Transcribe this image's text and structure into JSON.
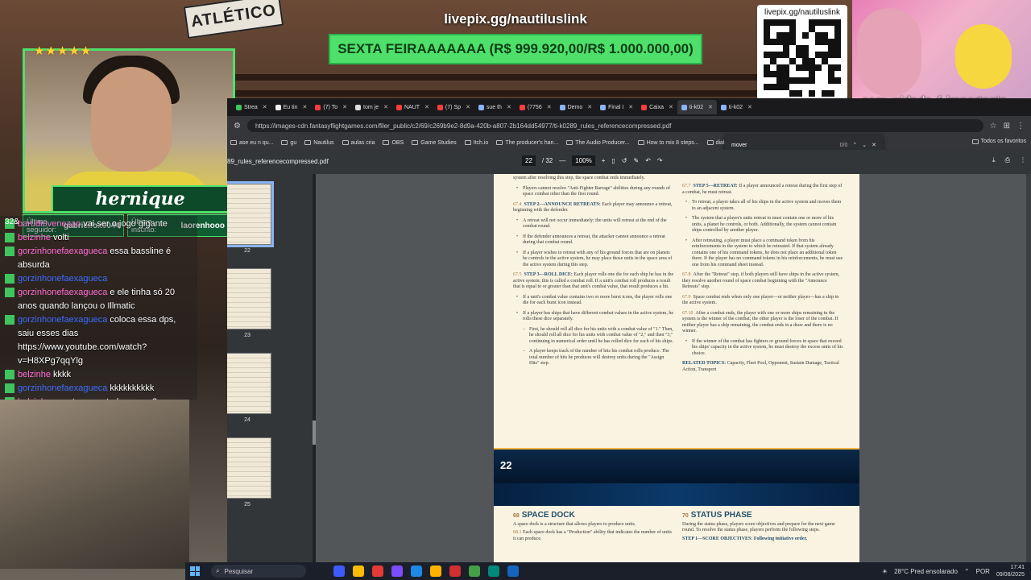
{
  "stream": {
    "overlay_url": "livepix.gg/nautiluslink",
    "goal_text": "SEXTA FEIRAAAAAAA (R$ 999.920,00/R$ 1.000.000,00)",
    "qr_url": "livepix.gg/nautiluslink",
    "cartoon_caption": "comunidade é importante",
    "pennant_text": "ATLÉTICO",
    "streamer_name": "hernique",
    "last_follower_label": "Último seguidor:",
    "last_follower": "gabrielfox0044",
    "last_subscriber_label": "Último inscrito:",
    "last_subscriber": "laorenhooo",
    "stars": "★★★★★",
    "chat_count": "32&",
    "chat": [
      {
        "user": "barudiovenezan",
        "msg": "vai ser o jogo gigante",
        "user_color": "#ff6bd5"
      },
      {
        "user": "belzinhe",
        "msg": "volti",
        "user_color": "#ff6bd5"
      },
      {
        "user": "gorzinhonefaexagueca",
        "msg": "essa bassline é absurda",
        "user_color": "#ff6bd5"
      },
      {
        "user": "gorzinhonefaexagueca",
        "msg": "",
        "user_color": "#3b6cff"
      },
      {
        "user": "gorzinhonefaexagueca",
        "msg": "e ele tinha só 20 anos quando lançou o Illmatic",
        "user_color": "#ff6bd5"
      },
      {
        "user": "gorzinhonefaexagueca",
        "msg": "coloca essa dps, saiu esses dias https://www.youtube.com/watch?v=H8XPg7qqYlg",
        "user_color": "#3b6cff"
      },
      {
        "user": "belzinhe",
        "msg": "kkkk",
        "user_color": "#ff6bd5"
      },
      {
        "user": "gorzinhonefaexagueca",
        "msg": "kkkkkkkkkk",
        "user_color": "#3b6cff"
      },
      {
        "user": "belzinhe",
        "msg": "mas toca em todos os ap?",
        "user_color": "#ff6bd5"
      }
    ]
  },
  "browser": {
    "tabs": [
      {
        "label": "Strea",
        "color": "#3fc45e"
      },
      {
        "label": "Eu tin",
        "color": "#f2f2f2"
      },
      {
        "label": "(7) To",
        "color": "#ff3d3d"
      },
      {
        "label": "tom je",
        "color": "#dddddd"
      },
      {
        "label": "NAUT",
        "color": "#ff3d3d"
      },
      {
        "label": "(7) Sp",
        "color": "#ff3d3d"
      },
      {
        "label": "sue th",
        "color": "#8ab4f8"
      },
      {
        "label": "(7756",
        "color": "#ff3d3d"
      },
      {
        "label": "Demo",
        "color": "#8ab4f8"
      },
      {
        "label": "Final I",
        "color": "#8ab4f8"
      },
      {
        "label": "Caixa",
        "color": "#ff3d3d"
      },
      {
        "label": "ti-k02",
        "color": "#8ab4f8"
      },
      {
        "label": "ti-k02",
        "color": "#8ab4f8"
      }
    ],
    "url": "https://images-cdn.fantasyflightgames.com/filer_public/c2/69/c269b9e2-8d9a-420b-a807-2b164dd54977/ti-k0289_rules_referencecompressed.pdf",
    "bookmarks": [
      "ase eu n qu...",
      "gu",
      "Nautilus",
      "aulas cria",
      "OBS",
      "Game Studies",
      "Itch.io",
      "The producer's han...",
      "The Audio Producer...",
      "How to mix 8 steps...",
      "dialog"
    ],
    "bookmarks_right": "Todos os favoritos",
    "find": {
      "value": "mover",
      "count": "0/0"
    },
    "pdf": {
      "filename": "89_rules_referencecompressed.pdf",
      "page_current": "22",
      "page_total": "/ 32",
      "zoom": "100%",
      "thumbnails": [
        "22",
        "23",
        "24",
        "25"
      ],
      "page_number_footer": "22",
      "left_column": [
        {
          "type": "text",
          "text": "system after resolving this step, the space combat ends immediately."
        },
        {
          "type": "bullet",
          "text": "Players cannot resolve \"Anti-Fighter Barrage\" abilities during any rounds of space combat other than the first round."
        },
        {
          "type": "head",
          "num": "67.4",
          "head": "STEP 2—ANNOUNCE RETREATS:",
          "text": "Each player may announce a retreat, beginning with the defender."
        },
        {
          "type": "bullet",
          "text": "A retreat will not occur immediately; the units will retreat at the end of the combat round."
        },
        {
          "type": "bullet",
          "text": "If the defender announces a retreat, the attacker cannot announce a retreat during that combat round."
        },
        {
          "type": "bullet",
          "text": "If a player wishes to retreat with any of his ground forces that are on planets he controls in the active system, he may place those units in the space area of the active system during this step."
        },
        {
          "type": "head",
          "num": "67.5",
          "head": "STEP 3—ROLL DICE:",
          "text": "Each player rolls one die for each ship he has in the active system; this is called a combat roll. If a unit's combat roll produces a result that is equal to or greater than that unit's combat value, that result produces a hit."
        },
        {
          "type": "bullet",
          "text": "If a unit's combat value contains two or more burst icons, the player rolls one die for each burst icon instead."
        },
        {
          "type": "bullet",
          "text": "If a player has ships that have different combat values in the active system, he rolls these dice separately."
        },
        {
          "type": "sub",
          "text": "First, he should roll all dice for his units with a combat value of \"1.\" Then, he should roll all dice for his units with combat value of \"2,\" and then \"3,\" continuing in numerical order until he has rolled dice for each of his ships."
        },
        {
          "type": "sub",
          "text": "A player keeps track of the number of hits his combat rolls produce. The total number of hits he produces will destroy units during the \"Assign Hits\" step."
        }
      ],
      "right_column": [
        {
          "type": "head",
          "num": "67.7",
          "head": "STEP 5—RETREAT:",
          "text": "If a player announced a retreat during the first step of a combat, he must retreat."
        },
        {
          "type": "bullet",
          "text": "To retreat, a player takes all of his ships in the active system and moves them to an adjacent system."
        },
        {
          "type": "bullet",
          "text": "The system that a player's units retreat to must contain one or more of his units, a planet he controls, or both. Additionally, the system cannot contain ships controlled by another player."
        },
        {
          "type": "bullet",
          "text": "After retreating, a player must place a command token from his reinforcements in the system to which he retreated. If that system already contains one of his command tokens, he does not place an additional token there. If the player has no command tokens in his reinforcements, he must use one from his command sheet instead."
        },
        {
          "type": "head",
          "num": "67.8",
          "head": "",
          "text": "After the \"Retreat\" step, if both players still have ships in the active system, they resolve another round of space combat beginning with the \"Announce Retreats\" step."
        },
        {
          "type": "head",
          "num": "67.9",
          "head": "",
          "text": "Space combat ends when only one player—or neither player—has a ship in the active system."
        },
        {
          "type": "head",
          "num": "67.10",
          "head": "",
          "text": "After a combat ends, the player with one or more ships remaining in the system is the winner of the combat; the other player is the loser of the combat. If neither player has a ship remaining, the combat ends in a draw and there is no winner."
        },
        {
          "type": "bullet",
          "text": "If the winner of the combat has fighters or ground forces in space that exceed his ships' capacity in the active system, he must destroy the excess units of his choice."
        },
        {
          "type": "related",
          "head": "RELATED TOPICS:",
          "text": "Capacity, Fleet Pool, Opponent, Sustain Damage, Tactical Action, Transport"
        }
      ],
      "next_page": {
        "left_num": "68",
        "left_title": "SPACE DOCK",
        "left_text": "A space dock is a structure that allows players to produce units.",
        "left_sub": "Each space dock has a \"Production\" ability that indicates the number of units it can produce.",
        "left_sub_num": "68.1",
        "right_num": "70",
        "right_title": "STATUS PHASE",
        "right_text": "During the status phase, players score objectives and prepare for the next game round. To resolve the status phase, players perform the following steps.",
        "right_sub": "STEP 1—SCORE OBJECTIVES: Following initiative order,"
      }
    }
  },
  "taskbar": {
    "search_placeholder": "Pesquisar",
    "weather": "28°C Pred ensolarado",
    "language": "POR",
    "time": "17:41",
    "date": "09/08/2025"
  }
}
